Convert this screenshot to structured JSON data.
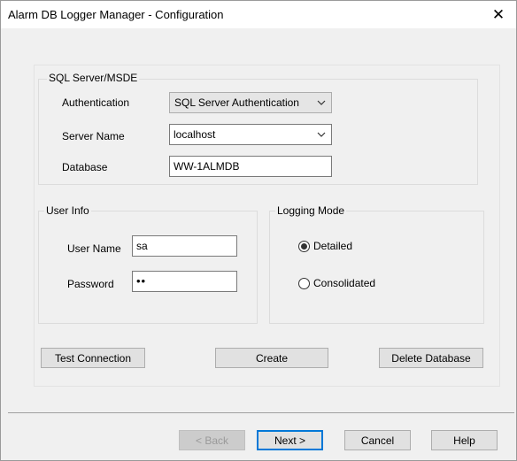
{
  "window": {
    "title": "Alarm DB Logger Manager - Configuration",
    "close_glyph": "✕"
  },
  "sql_server": {
    "group_label": "SQL Server/MSDE",
    "auth_label": "Authentication",
    "auth_value": "SQL Server Authentication",
    "server_label": "Server Name",
    "server_value": "localhost",
    "database_label": "Database",
    "database_value": "WW-1ALMDB"
  },
  "user_info": {
    "group_label": "User Info",
    "username_label": "User Name",
    "username_value": "sa",
    "password_label": "Password",
    "password_value": "••"
  },
  "logging_mode": {
    "group_label": "Logging Mode",
    "options": [
      {
        "label": "Detailed",
        "checked": true
      },
      {
        "label": "Consolidated",
        "checked": false
      }
    ]
  },
  "actions": {
    "test_connection": "Test Connection",
    "create": "Create",
    "delete_database": "Delete Database"
  },
  "nav": {
    "back": "< Back",
    "next": "Next >",
    "cancel": "Cancel",
    "help": "Help"
  },
  "icons": {
    "close": "close-icon",
    "chevron": "chevron-down-icon",
    "radio": "radio-icon"
  }
}
